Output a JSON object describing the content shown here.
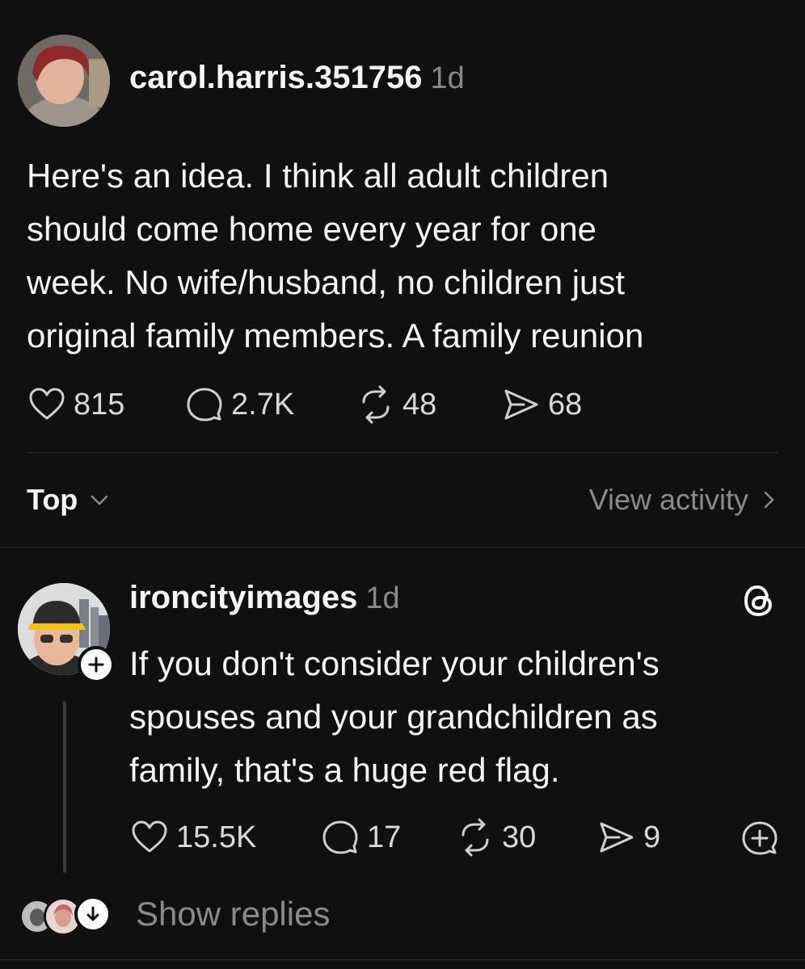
{
  "post": {
    "username": "carol.harris.351756",
    "time": "1d",
    "text_lines": [
      "Here's an idea. I think all adult children",
      "should come home every year for one",
      "week. No wife/husband, no children just",
      "original family members. A family reunion"
    ],
    "likes": "815",
    "replies": "2.7K",
    "reposts": "48",
    "shares": "68"
  },
  "sort": {
    "label": "Top",
    "view_activity": "View activity"
  },
  "reply": {
    "username": "ironcityimages",
    "time": "1d",
    "text_lines": [
      "If you don't consider your children's",
      "spouses and your grandchildren as",
      "family, that's a huge red flag."
    ],
    "likes": "15.5K",
    "replies": "17",
    "reposts": "30",
    "shares": "9"
  },
  "show_replies": "Show replies",
  "icons": {
    "like": "heart-icon",
    "reply": "comment-icon",
    "repost": "repost-icon",
    "share": "send-icon",
    "threads": "threads-logo-icon",
    "quote": "quote-add-icon",
    "follow": "plus-icon",
    "expand": "arrow-down-icon"
  }
}
